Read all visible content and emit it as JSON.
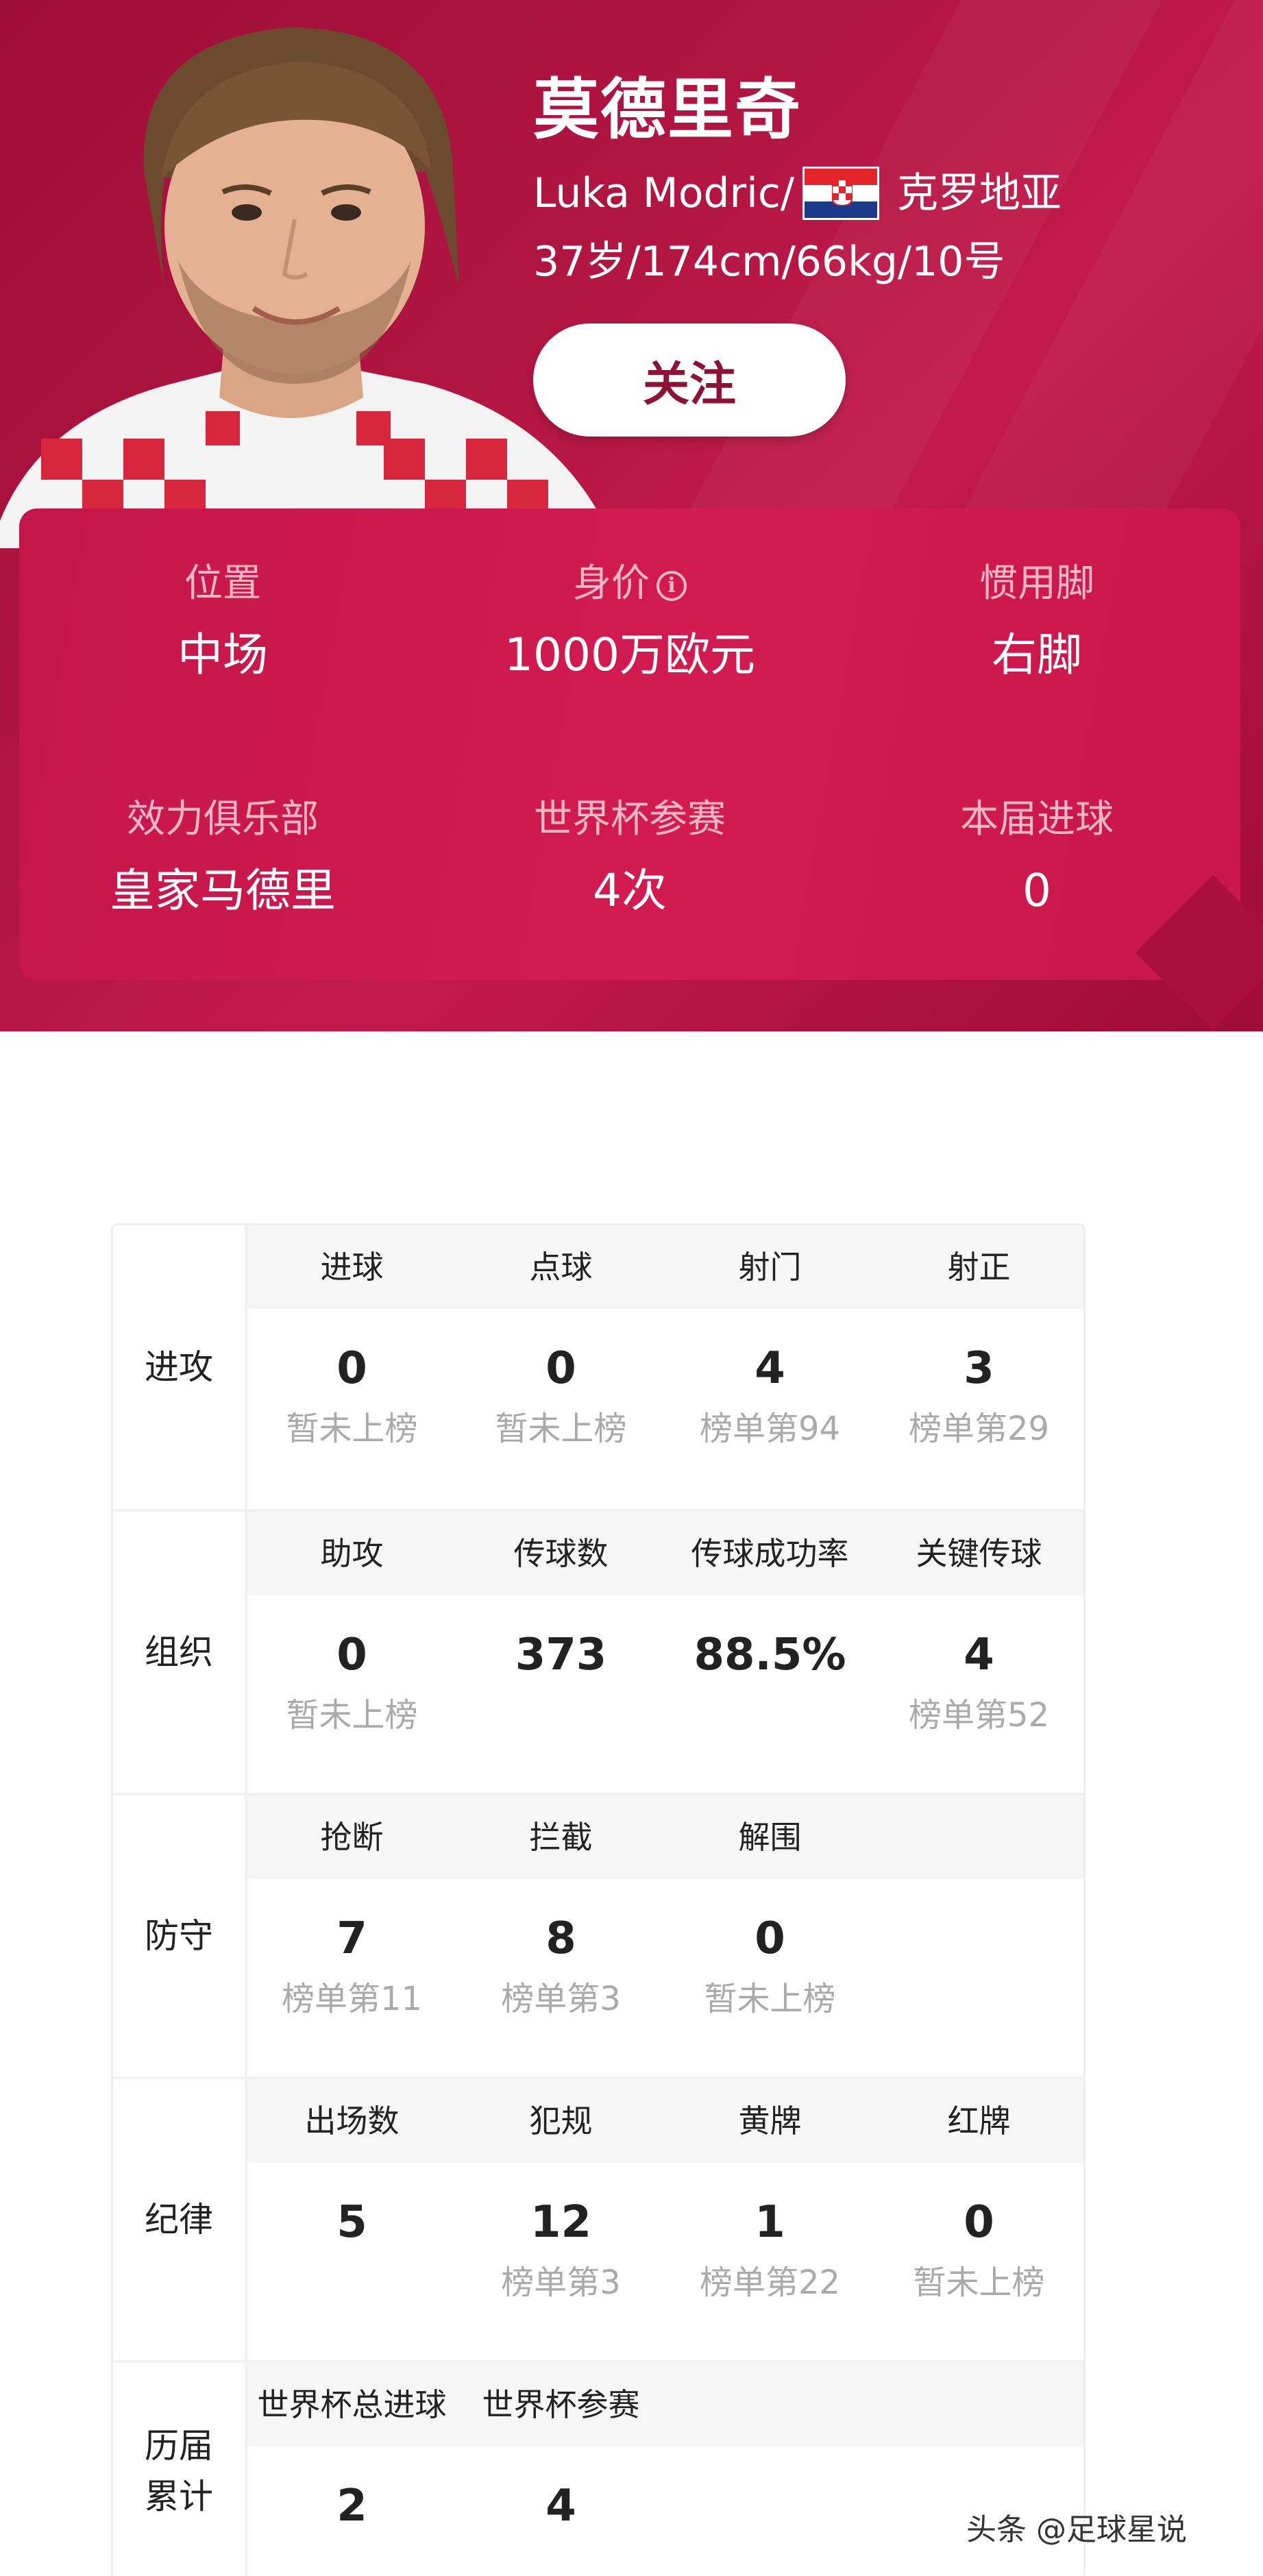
{
  "player": {
    "name_cn": "莫德里奇",
    "name_en": "Luka Modric/",
    "country": "克罗地亚",
    "meta": "37岁/174cm/66kg/10号",
    "follow_label": "关注"
  },
  "colors": {
    "header_bg": "#b01542",
    "card_bg": "#d21b51",
    "follow_text": "#8e1234",
    "rank_text": "#aaaaaa"
  },
  "icons": {
    "info": "info-circle-icon",
    "flag": "croatia-flag-icon",
    "player_photo": "player-portrait"
  },
  "summary": [
    {
      "label": "位置",
      "value": "中场"
    },
    {
      "label": "身价",
      "value": "1000万欧元"
    },
    {
      "label": "惯用脚",
      "value": "右脚"
    },
    {
      "label": "效力俱乐部",
      "value": "皇家马德里"
    },
    {
      "label": "世界杯参赛",
      "value": "4次"
    },
    {
      "label": "本届进球",
      "value": "0"
    }
  ],
  "table": [
    {
      "category": "进攻",
      "columns": [
        {
          "header": "进球",
          "value": "0",
          "rank": "暂未上榜"
        },
        {
          "header": "点球",
          "value": "0",
          "rank": "暂未上榜"
        },
        {
          "header": "射门",
          "value": "4",
          "rank": "榜单第94"
        },
        {
          "header": "射正",
          "value": "3",
          "rank": "榜单第29"
        }
      ]
    },
    {
      "category": "组织",
      "columns": [
        {
          "header": "助攻",
          "value": "0",
          "rank": "暂未上榜"
        },
        {
          "header": "传球数",
          "value": "373",
          "rank": ""
        },
        {
          "header": "传球成功率",
          "value": "88.5%",
          "rank": ""
        },
        {
          "header": "关键传球",
          "value": "4",
          "rank": "榜单第52"
        }
      ]
    },
    {
      "category": "防守",
      "columns": [
        {
          "header": "抢断",
          "value": "7",
          "rank": "榜单第11"
        },
        {
          "header": "拦截",
          "value": "8",
          "rank": "榜单第3"
        },
        {
          "header": "解围",
          "value": "0",
          "rank": "暂未上榜"
        },
        {
          "header": "",
          "value": "",
          "rank": ""
        }
      ]
    },
    {
      "category": "纪律",
      "columns": [
        {
          "header": "出场数",
          "value": "5",
          "rank": ""
        },
        {
          "header": "犯规",
          "value": "12",
          "rank": "榜单第3"
        },
        {
          "header": "黄牌",
          "value": "1",
          "rank": "榜单第22"
        },
        {
          "header": "红牌",
          "value": "0",
          "rank": "暂未上榜"
        }
      ]
    },
    {
      "category_line1": "历届",
      "category_line2": "累计",
      "columns": [
        {
          "header": "世界杯总进球",
          "value": "2",
          "rank": ""
        },
        {
          "header": "世界杯参赛",
          "value": "4",
          "rank": ""
        },
        {
          "header": "",
          "value": "",
          "rank": ""
        },
        {
          "header": "",
          "value": "",
          "rank": ""
        }
      ]
    }
  ],
  "watermark": "头条 @足球星说"
}
